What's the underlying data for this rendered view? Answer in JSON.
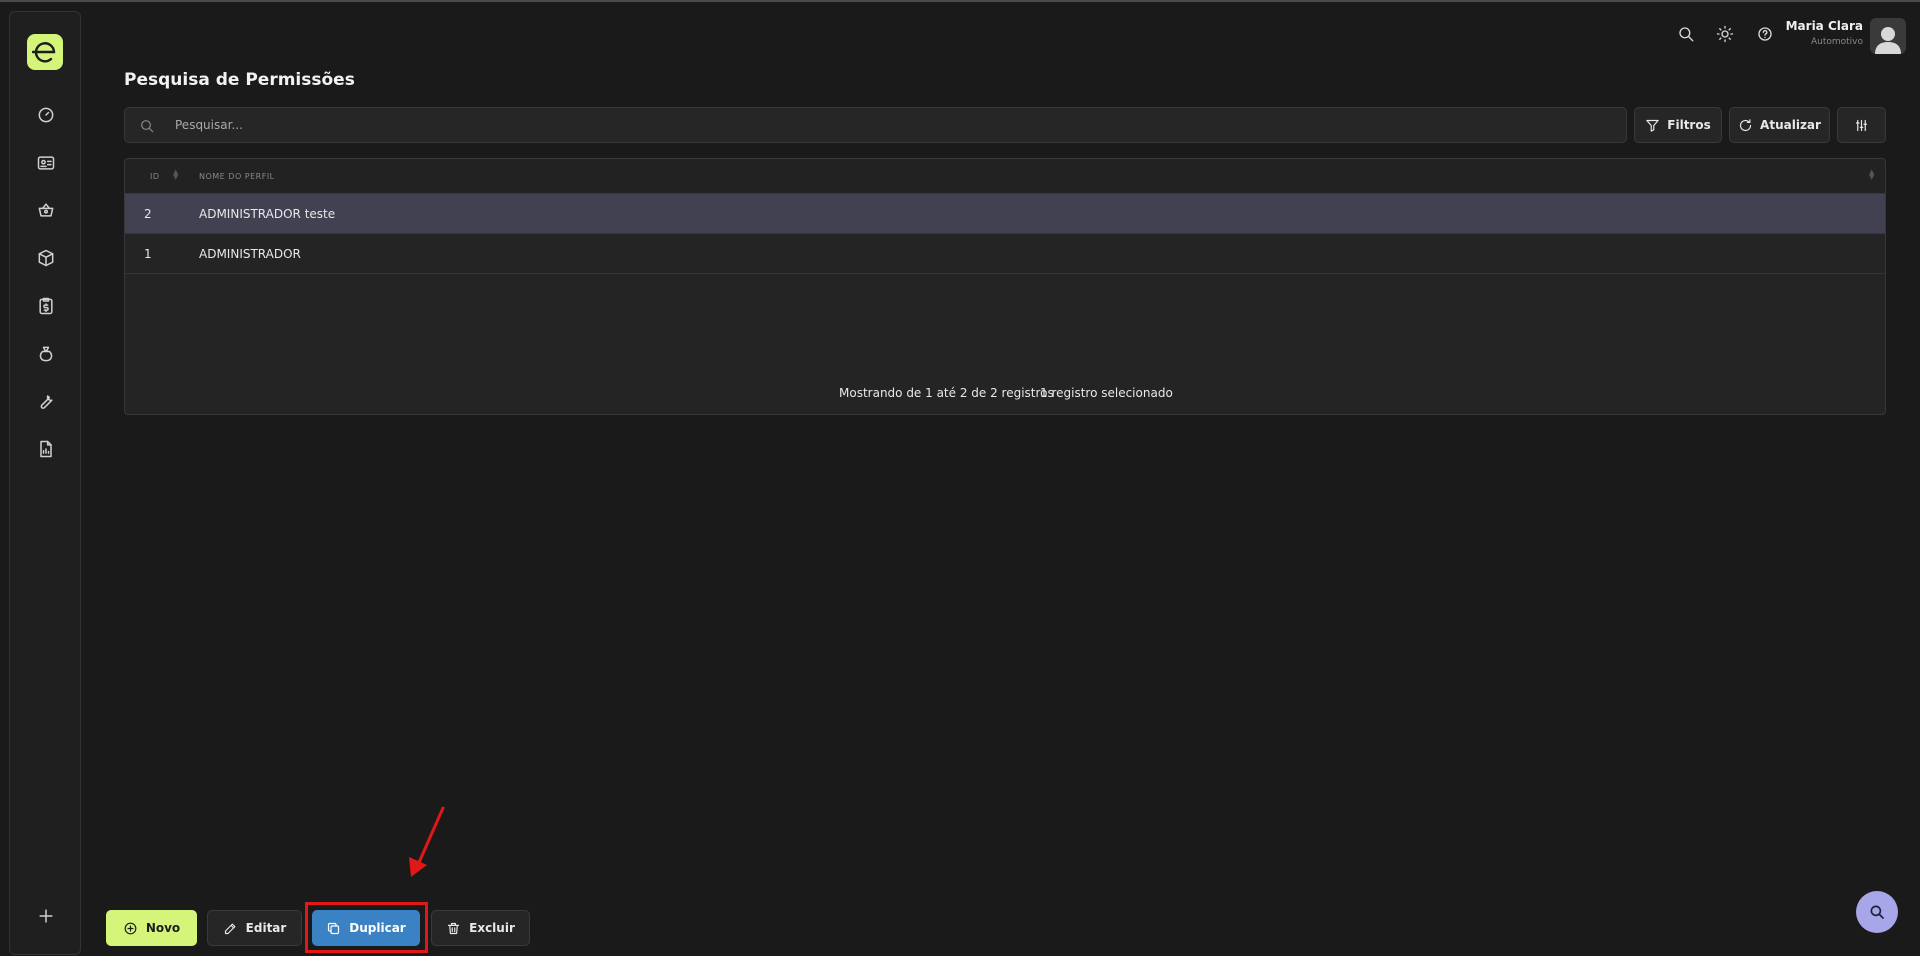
{
  "header": {
    "user_name": "Maria Clara",
    "user_subtitle": "Automotivo"
  },
  "page": {
    "title": "Pesquisa de Permissões"
  },
  "search": {
    "placeholder": "Pesquisar..."
  },
  "toolbar": {
    "filters_label": "Filtros",
    "refresh_label": "Atualizar"
  },
  "table": {
    "columns": [
      "ID",
      "NOME DO PERFIL"
    ],
    "rows": [
      {
        "id": "2",
        "name": "ADMINISTRADOR teste",
        "selected": true
      },
      {
        "id": "1",
        "name": "ADMINISTRADOR",
        "selected": false
      }
    ],
    "footer_count": "Mostrando de 1 até 2 de 2 registros",
    "footer_selected": "1 registro selecionado"
  },
  "actions": {
    "new_label": "Novo",
    "edit_label": "Editar",
    "duplicate_label": "Duplicar",
    "delete_label": "Excluir"
  },
  "colors": {
    "accent": "#d4f57a",
    "duplicate": "#3b82c4",
    "selected_row": "#414152",
    "highlight": "#e01818",
    "fab": "#a6a6e8"
  }
}
